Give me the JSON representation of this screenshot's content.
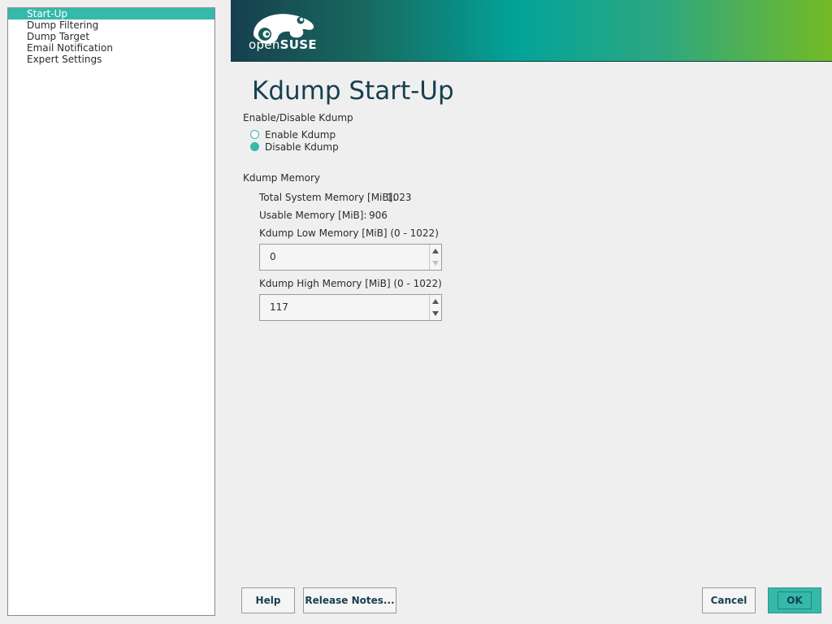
{
  "sidebar": {
    "items": [
      {
        "label": "Start-Up",
        "selected": true
      },
      {
        "label": "Dump Filtering",
        "selected": false
      },
      {
        "label": "Dump Target",
        "selected": false
      },
      {
        "label": "Email Notification",
        "selected": false
      },
      {
        "label": "Expert Settings",
        "selected": false
      }
    ]
  },
  "header": {
    "logo_text_thin": "open",
    "logo_text_bold": "SUSE",
    "gradient_colors": [
      "#173f4f",
      "#02a49a",
      "#73ba25"
    ]
  },
  "main": {
    "title": "Kdump Start-Up",
    "enable_group": {
      "label": "Enable/Disable Kdump",
      "options": [
        {
          "label": "Enable Kdump",
          "checked": false
        },
        {
          "label": "Disable Kdump",
          "checked": true
        }
      ]
    },
    "memory_group": {
      "label": "Kdump Memory",
      "total_label": "Total System Memory [MiB]:",
      "total_value": "1023",
      "usable_label": "Usable Memory [MiB]:",
      "usable_value": "906",
      "low_label": "Kdump Low Memory [MiB] (0 - 1022)",
      "low_value": "0",
      "high_label": "Kdump High Memory [MiB] (0 - 1022)",
      "high_value": "117"
    }
  },
  "buttons": {
    "help": "Help",
    "release_notes": "Release Notes...",
    "cancel": "Cancel",
    "ok": "OK"
  },
  "colors": {
    "accent": "#35b9ab",
    "title": "#173f4f"
  }
}
